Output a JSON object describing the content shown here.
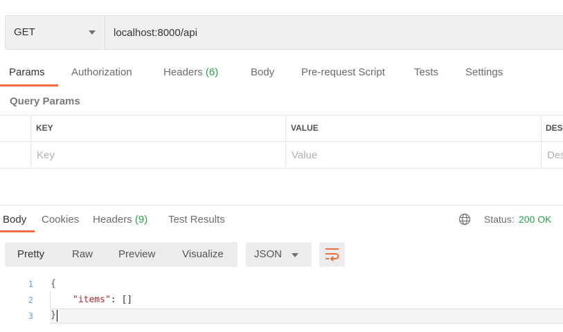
{
  "request": {
    "method": "GET",
    "url": "localhost:8000/api"
  },
  "request_tabs": [
    {
      "label": "Params",
      "badge": ""
    },
    {
      "label": "Authorization",
      "badge": ""
    },
    {
      "label": "Headers",
      "badge": "(6)"
    },
    {
      "label": "Body",
      "badge": ""
    },
    {
      "label": "Pre-request Script",
      "badge": ""
    },
    {
      "label": "Tests",
      "badge": ""
    },
    {
      "label": "Settings",
      "badge": ""
    }
  ],
  "query_params": {
    "title": "Query Params",
    "columns": [
      "KEY",
      "VALUE",
      "DESC"
    ],
    "placeholders": {
      "key": "Key",
      "value": "Value",
      "description": "Des"
    }
  },
  "response_tabs": [
    {
      "label": "Body",
      "badge": ""
    },
    {
      "label": "Cookies",
      "badge": ""
    },
    {
      "label": "Headers",
      "badge": "(9)"
    },
    {
      "label": "Test Results",
      "badge": ""
    }
  ],
  "status": {
    "label": "Status:",
    "value": "200 OK"
  },
  "view_modes": [
    "Pretty",
    "Raw",
    "Preview",
    "Visualize"
  ],
  "format": "JSON",
  "code": {
    "line_numbers": [
      "1",
      "2",
      "3"
    ],
    "open_brace": "{",
    "key": "\"items\"",
    "separator": ": []",
    "close_brace": "}"
  },
  "colors": {
    "accent": "#f26b3a",
    "success": "#26a14a"
  },
  "icons": [
    "chevron-down-icon",
    "globe-icon",
    "wrap-lines-icon"
  ]
}
